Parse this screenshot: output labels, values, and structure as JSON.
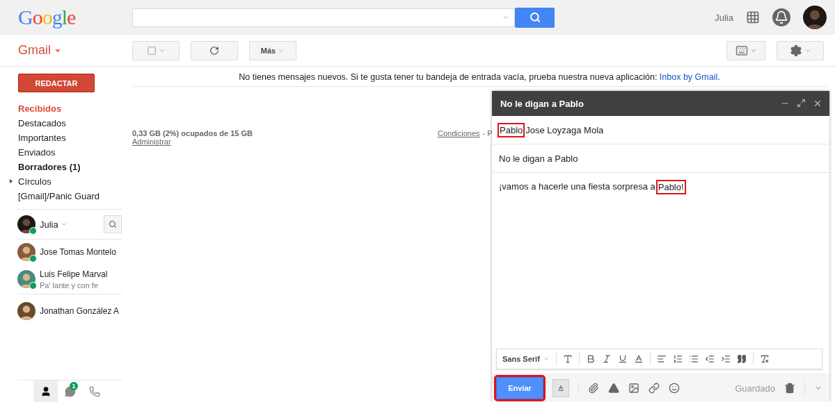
{
  "header": {
    "logo": "Google",
    "user_name": "Julia"
  },
  "toolbar": {
    "app_menu": "Gmail",
    "more_button": "Más"
  },
  "sidebar": {
    "compose_button": "REDACTAR",
    "folders": [
      {
        "label": "Recibidos",
        "selected": true,
        "bold": true,
        "expandable": false
      },
      {
        "label": "Destacados",
        "selected": false,
        "bold": false,
        "expandable": false
      },
      {
        "label": "Importantes",
        "selected": false,
        "bold": false,
        "expandable": false
      },
      {
        "label": "Enviados",
        "selected": false,
        "bold": false,
        "expandable": false
      },
      {
        "label": "Borradores (1)",
        "selected": false,
        "bold": true,
        "expandable": false
      },
      {
        "label": "Círculos",
        "selected": false,
        "bold": false,
        "expandable": true
      },
      {
        "label": "[Gmail]/Panic Guard",
        "selected": false,
        "bold": false,
        "expandable": false
      }
    ],
    "chat": {
      "me": {
        "name": "Julia",
        "online": true
      },
      "contacts": [
        {
          "name": "Jose Tomas Montelo",
          "online": true
        },
        {
          "name": "Luis Felipe Marval",
          "status": "Pa' lante y con fe",
          "online": true
        },
        {
          "name": "Jonathan González A",
          "online": false
        }
      ],
      "tabs": [
        {
          "kind": "contacts",
          "selected": true
        },
        {
          "kind": "hangouts",
          "selected": false,
          "badge": "1"
        },
        {
          "kind": "phone",
          "selected": false
        }
      ]
    }
  },
  "main": {
    "notice": "No tienes mensajes nuevos. Si te gusta tener tu bandeja de entrada vacía, prueba nuestra nueva aplicación:",
    "notice_link": "Inbox by Gmail",
    "notice_end": ".",
    "storage": "0,33 GB (2%) ocupados de 15 GB",
    "manage_link": "Administrar",
    "terms_link": "Condiciones",
    "terms_rest": "- P"
  },
  "compose": {
    "title": "No le digan a Pablo",
    "to": [
      {
        "text": "Pablo",
        "highlighted": true
      },
      {
        "text": "Jose Loyzaga Mola",
        "highlighted": false
      }
    ],
    "subject": "No le digan a Pablo",
    "body": [
      {
        "text": "¡vamos a hacerle una fiesta sorpresa a",
        "highlighted": false
      },
      {
        "text": "Pablo!",
        "highlighted": true
      }
    ],
    "font_name": "Sans Serif",
    "send_button": {
      "label": "Enviar",
      "highlighted": true
    },
    "saved_status": "Guardado"
  }
}
